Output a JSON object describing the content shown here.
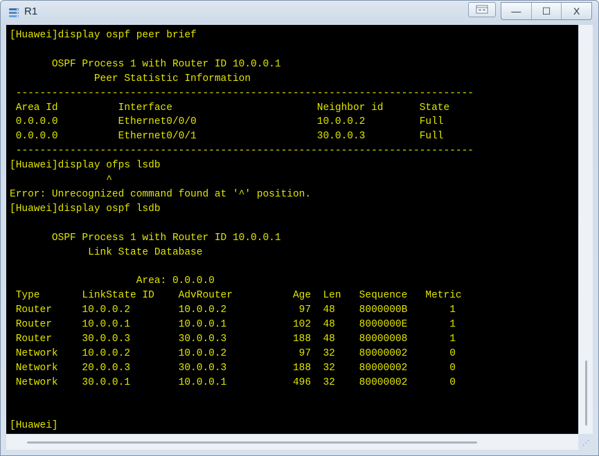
{
  "window": {
    "title": "R1",
    "icon": "router-app-icon",
    "controls": {
      "extra_icon": "window-options-icon",
      "minimize": "—",
      "maximize": "☐",
      "close": "X"
    }
  },
  "terminal": {
    "text_color": "#e1e600",
    "background": "#000000",
    "lines": [
      "[Huawei]display ospf peer brief",
      "",
      "       OSPF Process 1 with Router ID 10.0.0.1",
      "              Peer Statistic Information",
      " ----------------------------------------------------------------------------",
      " Area Id          Interface                        Neighbor id      State",
      " 0.0.0.0          Ethernet0/0/0                    10.0.0.2         Full",
      " 0.0.0.0          Ethernet0/0/1                    30.0.0.3         Full",
      " ----------------------------------------------------------------------------",
      "[Huawei]display ofps lsdb",
      "                ^",
      "Error: Unrecognized command found at '^' position.",
      "[Huawei]display ospf lsdb",
      "",
      "       OSPF Process 1 with Router ID 10.0.0.1",
      "             Link State Database",
      "",
      "                     Area: 0.0.0.0",
      " Type       LinkState ID    AdvRouter          Age  Len   Sequence   Metric",
      " Router     10.0.0.2        10.0.0.2            97  48    8000000B       1",
      " Router     10.0.0.1        10.0.0.1           102  48    8000000E       1",
      " Router     30.0.0.3        30.0.0.3           188  48    80000008       1",
      " Network    10.0.0.2        10.0.0.2            97  32    80000002       0",
      " Network    20.0.0.3        30.0.0.3           188  32    80000002       0",
      " Network    30.0.0.1        10.0.0.1           496  32    80000002       0",
      "",
      "",
      "[Huawei]"
    ]
  }
}
